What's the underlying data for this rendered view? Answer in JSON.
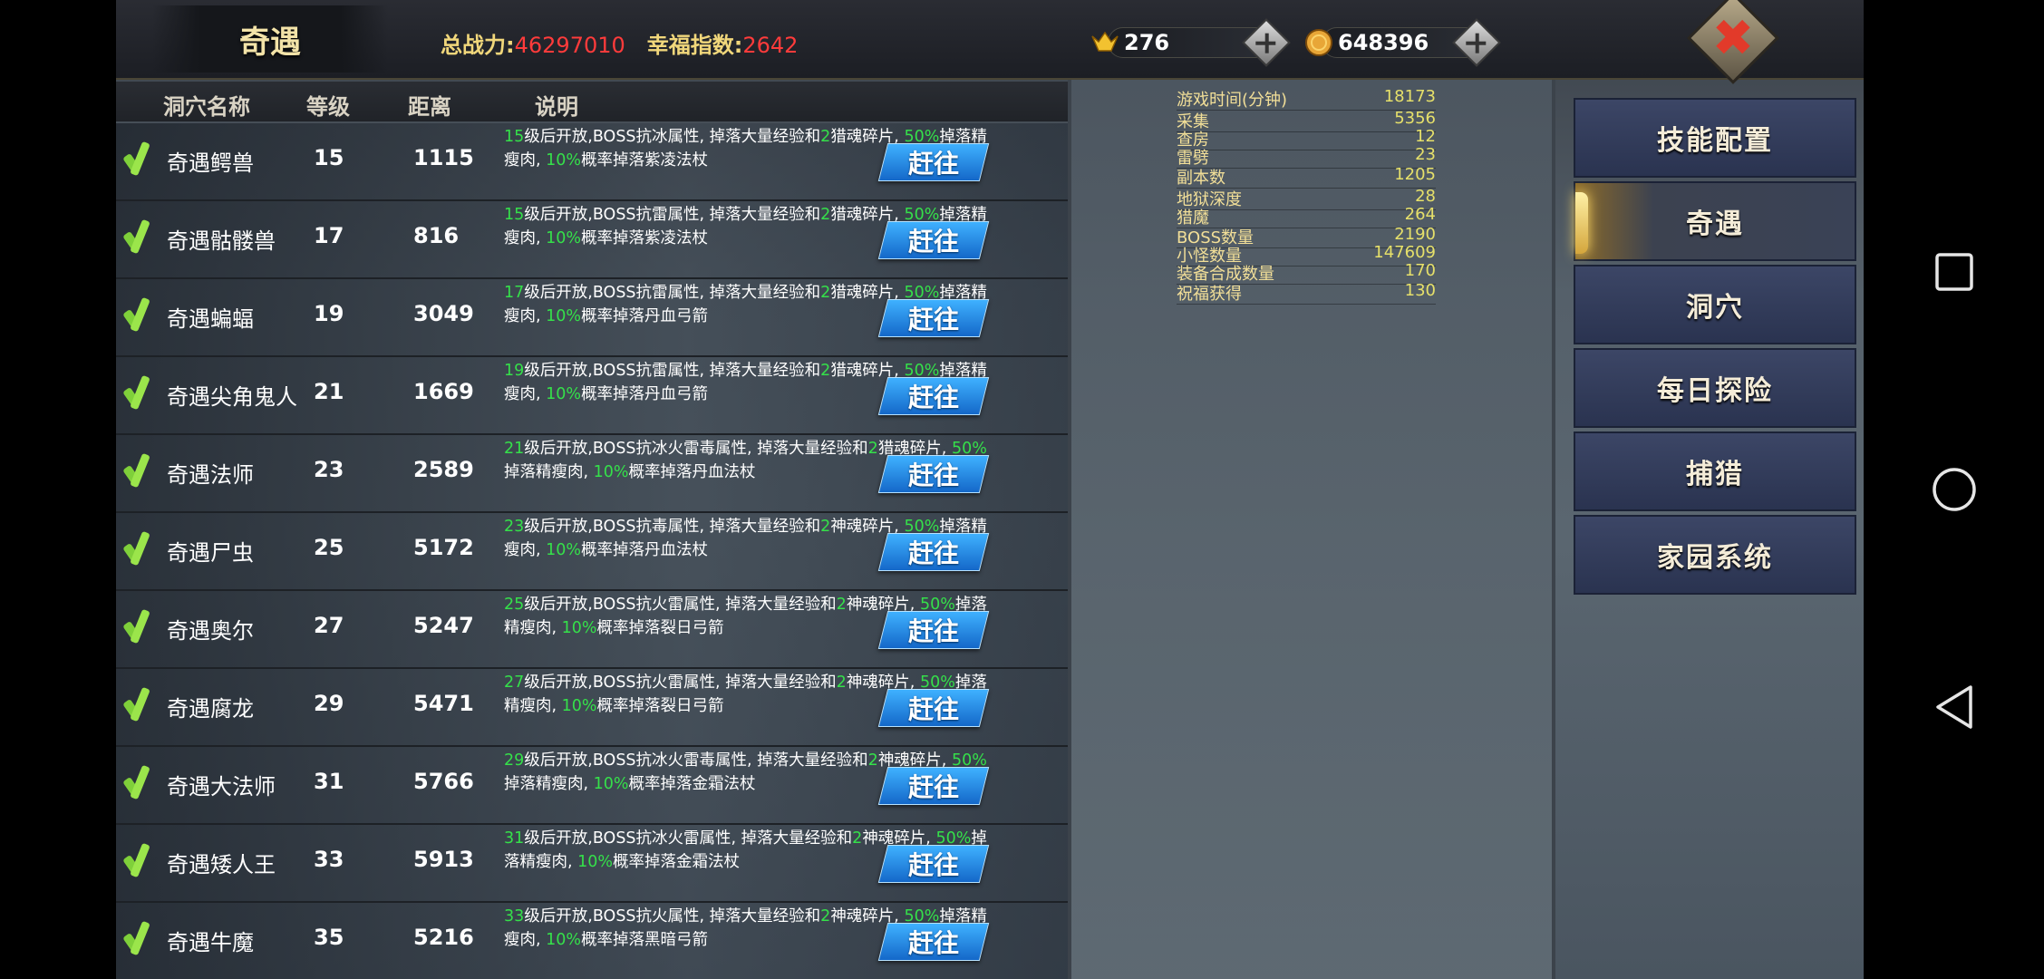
{
  "header": {
    "title": "奇遇",
    "power_label": "总战力:",
    "power_value": "46297010",
    "happiness_label": "幸福指数:",
    "happiness_value": "2642",
    "ingots": "276",
    "coins": "648396",
    "close_symbol": "✖"
  },
  "columns": [
    "洞穴名称",
    "等级",
    "距离",
    "说明"
  ],
  "goto_label": "赶往",
  "rows": [
    {
      "name": "奇遇鳄兽",
      "level": "15",
      "distance": "1115",
      "desc": [
        [
          "g",
          "15"
        ],
        [
          "t",
          "级后开放,BOSS抗冰属性, 掉落大量经验和"
        ],
        [
          "g",
          "2"
        ],
        [
          "t",
          "猎魂碎片, "
        ],
        [
          "g",
          "50%"
        ],
        [
          "t",
          "掉落精瘦肉, "
        ],
        [
          "g",
          "10%"
        ],
        [
          "t",
          "概率掉落紫凌法杖"
        ]
      ]
    },
    {
      "name": "奇遇骷髅兽",
      "level": "17",
      "distance": "816",
      "desc": [
        [
          "g",
          "15"
        ],
        [
          "t",
          "级后开放,BOSS抗雷属性, 掉落大量经验和"
        ],
        [
          "g",
          "2"
        ],
        [
          "t",
          "猎魂碎片, "
        ],
        [
          "g",
          "50%"
        ],
        [
          "t",
          "掉落精瘦肉, "
        ],
        [
          "g",
          "10%"
        ],
        [
          "t",
          "概率掉落紫凌法杖"
        ]
      ]
    },
    {
      "name": "奇遇蝙蝠",
      "level": "19",
      "distance": "3049",
      "desc": [
        [
          "g",
          "17"
        ],
        [
          "t",
          "级后开放,BOSS抗雷属性, 掉落大量经验和"
        ],
        [
          "g",
          "2"
        ],
        [
          "t",
          "猎魂碎片, "
        ],
        [
          "g",
          "50%"
        ],
        [
          "t",
          "掉落精瘦肉, "
        ],
        [
          "g",
          "10%"
        ],
        [
          "t",
          "概率掉落丹血弓箭"
        ]
      ]
    },
    {
      "name": "奇遇尖角鬼人",
      "level": "21",
      "distance": "1669",
      "desc": [
        [
          "g",
          "19"
        ],
        [
          "t",
          "级后开放,BOSS抗雷属性, 掉落大量经验和"
        ],
        [
          "g",
          "2"
        ],
        [
          "t",
          "猎魂碎片, "
        ],
        [
          "g",
          "50%"
        ],
        [
          "t",
          "掉落精瘦肉, "
        ],
        [
          "g",
          "10%"
        ],
        [
          "t",
          "概率掉落丹血弓箭"
        ]
      ]
    },
    {
      "name": "奇遇法师",
      "level": "23",
      "distance": "2589",
      "desc": [
        [
          "g",
          "21"
        ],
        [
          "t",
          "级后开放,BOSS抗冰火雷毒属性, 掉落大量经验和"
        ],
        [
          "g",
          "2"
        ],
        [
          "t",
          "猎魂碎片, "
        ],
        [
          "g",
          "50%"
        ],
        [
          "t",
          "掉落精瘦肉, "
        ],
        [
          "g",
          "10%"
        ],
        [
          "t",
          "概率掉落丹血法杖"
        ]
      ]
    },
    {
      "name": "奇遇尸虫",
      "level": "25",
      "distance": "5172",
      "desc": [
        [
          "g",
          "23"
        ],
        [
          "t",
          "级后开放,BOSS抗毒属性, 掉落大量经验和"
        ],
        [
          "g",
          "2"
        ],
        [
          "t",
          "神魂碎片, "
        ],
        [
          "g",
          "50%"
        ],
        [
          "t",
          "掉落精瘦肉, "
        ],
        [
          "g",
          "10%"
        ],
        [
          "t",
          "概率掉落丹血法杖"
        ]
      ]
    },
    {
      "name": "奇遇奥尔",
      "level": "27",
      "distance": "5247",
      "desc": [
        [
          "g",
          "25"
        ],
        [
          "t",
          "级后开放,BOSS抗火雷属性, 掉落大量经验和"
        ],
        [
          "g",
          "2"
        ],
        [
          "t",
          "神魂碎片, "
        ],
        [
          "g",
          "50%"
        ],
        [
          "t",
          "掉落精瘦肉, "
        ],
        [
          "g",
          "10%"
        ],
        [
          "t",
          "概率掉落裂日弓箭"
        ]
      ]
    },
    {
      "name": "奇遇腐龙",
      "level": "29",
      "distance": "5471",
      "desc": [
        [
          "g",
          "27"
        ],
        [
          "t",
          "级后开放,BOSS抗火雷属性, 掉落大量经验和"
        ],
        [
          "g",
          "2"
        ],
        [
          "t",
          "神魂碎片, "
        ],
        [
          "g",
          "50%"
        ],
        [
          "t",
          "掉落精瘦肉, "
        ],
        [
          "g",
          "10%"
        ],
        [
          "t",
          "概率掉落裂日弓箭"
        ]
      ]
    },
    {
      "name": "奇遇大法师",
      "level": "31",
      "distance": "5766",
      "desc": [
        [
          "g",
          "29"
        ],
        [
          "t",
          "级后开放,BOSS抗冰火雷毒属性, 掉落大量经验和"
        ],
        [
          "g",
          "2"
        ],
        [
          "t",
          "神魂碎片, "
        ],
        [
          "g",
          "50%"
        ],
        [
          "t",
          "掉落精瘦肉, "
        ],
        [
          "g",
          "10%"
        ],
        [
          "t",
          "概率掉落金霜法杖"
        ]
      ]
    },
    {
      "name": "奇遇矮人王",
      "level": "33",
      "distance": "5913",
      "desc": [
        [
          "g",
          "31"
        ],
        [
          "t",
          "级后开放,BOSS抗冰火雷属性, 掉落大量经验和"
        ],
        [
          "g",
          "2"
        ],
        [
          "t",
          "神魂碎片, "
        ],
        [
          "g",
          "50%"
        ],
        [
          "t",
          "掉落精瘦肉, "
        ],
        [
          "g",
          "10%"
        ],
        [
          "t",
          "概率掉落金霜法杖"
        ]
      ]
    },
    {
      "name": "奇遇牛魔",
      "level": "35",
      "distance": "5216",
      "desc": [
        [
          "g",
          "33"
        ],
        [
          "t",
          "级后开放,BOSS抗火属性, 掉落大量经验和"
        ],
        [
          "g",
          "2"
        ],
        [
          "t",
          "神魂碎片, "
        ],
        [
          "g",
          "50%"
        ],
        [
          "t",
          "掉落精瘦肉, "
        ],
        [
          "g",
          "10%"
        ],
        [
          "t",
          "概率掉落黑暗弓箭"
        ]
      ]
    }
  ],
  "stats": [
    {
      "label": "游戏时间(分钟)",
      "value": "18173"
    },
    {
      "label": "采集",
      "value": "5356"
    },
    {
      "label": "查房",
      "value": "12"
    },
    {
      "label": "雷劈",
      "value": "23"
    },
    {
      "label": "副本数",
      "value": "1205"
    },
    {
      "label": "地狱深度",
      "value": "28"
    },
    {
      "label": "猎魔",
      "value": "264"
    },
    {
      "label": "BOSS数量",
      "value": "2190"
    },
    {
      "label": "小怪数量",
      "value": "147609"
    },
    {
      "label": "装备合成数量",
      "value": "170"
    },
    {
      "label": "祝福获得",
      "value": "130"
    }
  ],
  "menu": [
    {
      "label": "技能配置",
      "active": false
    },
    {
      "label": "奇遇",
      "active": true
    },
    {
      "label": "洞穴",
      "active": false
    },
    {
      "label": "每日探险",
      "active": false
    },
    {
      "label": "捕猎",
      "active": false
    },
    {
      "label": "家园系统",
      "active": false
    }
  ],
  "colors": {
    "gold": "#f1d77b",
    "red_value": "#ff3b3b",
    "green": "#35e04a",
    "button_blue": "#1f8ae6"
  },
  "icons": {
    "ingot": "gold-ingot-icon",
    "coin": "gold-coin-icon",
    "close": "close-icon",
    "check": "checkmark-icon"
  }
}
